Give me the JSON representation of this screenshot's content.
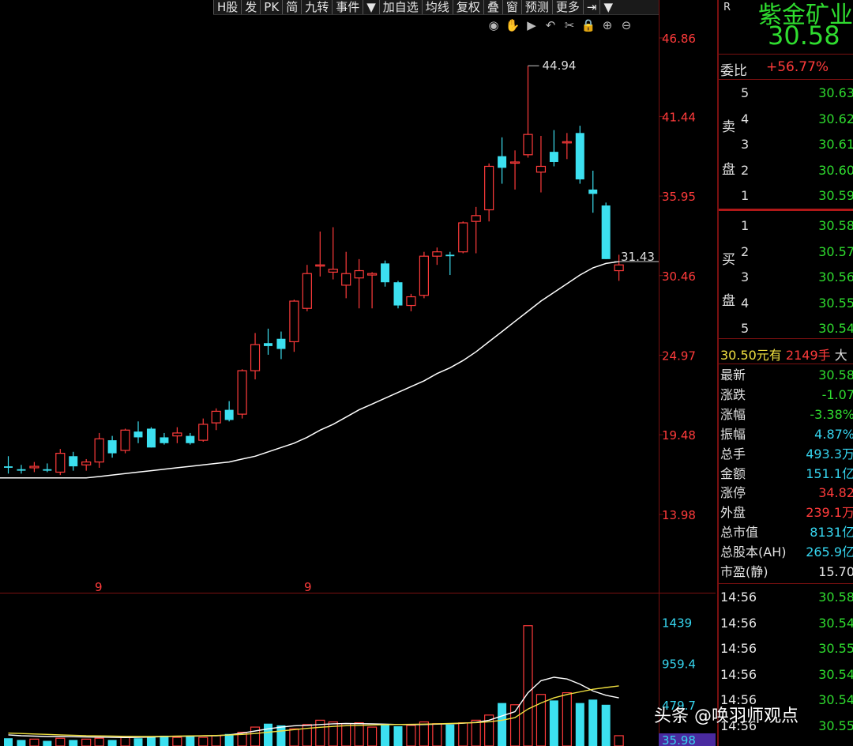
{
  "toolbar": {
    "items": [
      "H股",
      "发",
      "PK",
      "简",
      "九转",
      "事件",
      "▼",
      "加自选",
      "均线",
      "复权",
      "叠",
      "窗",
      "预测",
      "更多",
      "⇥",
      "▼"
    ]
  },
  "chart_tools": {
    "icons": [
      "eye-icon",
      "hand-icon",
      "play-icon",
      "undo-icon",
      "scissors-icon",
      "lock-icon",
      "zoom-in-icon",
      "zoom-out-icon"
    ]
  },
  "price_axis": {
    "ticks": [
      "46.86",
      "41.44",
      "35.95",
      "30.46",
      "24.97",
      "19.48",
      "13.98"
    ]
  },
  "volume_axis": {
    "ticks": [
      "1439",
      "959.4",
      "479.7",
      "35.98"
    ]
  },
  "annotations": {
    "high": "44.94",
    "ma_value": "31.43",
    "month_marks": [
      "9",
      "9"
    ]
  },
  "colors": {
    "up": "#ff3b3b",
    "down": "#3ce0f0",
    "ma": "#ffffff",
    "vol_ma1": "#ffffff",
    "vol_ma2": "#f0e040",
    "grid": "#7a1010"
  },
  "chart_data": {
    "type": "candlestick",
    "ylim": [
      13.98,
      46.86
    ],
    "candles": [
      {
        "o": 17.3,
        "h": 18.0,
        "l": 16.8,
        "c": 17.2
      },
      {
        "o": 17.1,
        "h": 17.4,
        "l": 16.8,
        "c": 17.0
      },
      {
        "o": 17.2,
        "h": 17.6,
        "l": 16.9,
        "c": 17.3
      },
      {
        "o": 17.1,
        "h": 17.5,
        "l": 16.9,
        "c": 17.0
      },
      {
        "o": 16.9,
        "h": 18.5,
        "l": 16.7,
        "c": 18.2
      },
      {
        "o": 18.0,
        "h": 18.3,
        "l": 17.0,
        "c": 17.3
      },
      {
        "o": 17.4,
        "h": 17.8,
        "l": 17.0,
        "c": 17.6
      },
      {
        "o": 17.6,
        "h": 19.6,
        "l": 17.2,
        "c": 19.2
      },
      {
        "o": 19.1,
        "h": 19.4,
        "l": 17.9,
        "c": 18.2
      },
      {
        "o": 18.4,
        "h": 19.9,
        "l": 18.2,
        "c": 19.8
      },
      {
        "o": 19.7,
        "h": 20.4,
        "l": 18.9,
        "c": 19.3
      },
      {
        "o": 19.9,
        "h": 20.0,
        "l": 18.6,
        "c": 18.6
      },
      {
        "o": 19.3,
        "h": 19.6,
        "l": 18.8,
        "c": 18.9
      },
      {
        "o": 19.4,
        "h": 20.0,
        "l": 18.9,
        "c": 19.6
      },
      {
        "o": 19.4,
        "h": 19.6,
        "l": 18.8,
        "c": 18.9
      },
      {
        "o": 19.1,
        "h": 20.6,
        "l": 19.0,
        "c": 20.2
      },
      {
        "o": 20.3,
        "h": 21.3,
        "l": 19.8,
        "c": 21.1
      },
      {
        "o": 21.2,
        "h": 21.8,
        "l": 20.4,
        "c": 20.5
      },
      {
        "o": 20.9,
        "h": 24.0,
        "l": 20.6,
        "c": 23.9
      },
      {
        "o": 23.9,
        "h": 26.5,
        "l": 23.3,
        "c": 25.7
      },
      {
        "o": 25.8,
        "h": 26.8,
        "l": 25.0,
        "c": 25.6
      },
      {
        "o": 26.1,
        "h": 26.6,
        "l": 24.7,
        "c": 25.4
      },
      {
        "o": 25.9,
        "h": 28.8,
        "l": 25.2,
        "c": 28.7
      },
      {
        "o": 28.2,
        "h": 31.2,
        "l": 28.0,
        "c": 30.6
      },
      {
        "o": 31.2,
        "h": 33.5,
        "l": 30.4,
        "c": 31.2
      },
      {
        "o": 30.7,
        "h": 33.8,
        "l": 30.2,
        "c": 30.9
      },
      {
        "o": 29.8,
        "h": 32.1,
        "l": 28.9,
        "c": 30.6
      },
      {
        "o": 30.3,
        "h": 31.6,
        "l": 28.2,
        "c": 30.8
      },
      {
        "o": 30.5,
        "h": 30.7,
        "l": 28.2,
        "c": 30.6
      },
      {
        "o": 31.3,
        "h": 31.5,
        "l": 29.7,
        "c": 30.0
      },
      {
        "o": 30.0,
        "h": 30.1,
        "l": 28.2,
        "c": 28.4
      },
      {
        "o": 28.4,
        "h": 29.2,
        "l": 28.0,
        "c": 29.0
      },
      {
        "o": 29.1,
        "h": 32.1,
        "l": 28.9,
        "c": 31.8
      },
      {
        "o": 31.8,
        "h": 32.4,
        "l": 31.2,
        "c": 32.1
      },
      {
        "o": 31.9,
        "h": 32.1,
        "l": 30.5,
        "c": 31.8
      },
      {
        "o": 32.1,
        "h": 34.2,
        "l": 32.0,
        "c": 34.1
      },
      {
        "o": 34.2,
        "h": 35.2,
        "l": 32.0,
        "c": 34.6
      },
      {
        "o": 35.0,
        "h": 38.2,
        "l": 34.2,
        "c": 38.0
      },
      {
        "o": 38.7,
        "h": 40.0,
        "l": 36.8,
        "c": 37.9
      },
      {
        "o": 38.3,
        "h": 39.1,
        "l": 36.4,
        "c": 38.3
      },
      {
        "o": 38.8,
        "h": 44.94,
        "l": 38.6,
        "c": 40.2
      },
      {
        "o": 37.6,
        "h": 40.1,
        "l": 36.2,
        "c": 38.0
      },
      {
        "o": 39.0,
        "h": 40.5,
        "l": 38.0,
        "c": 38.3
      },
      {
        "o": 39.7,
        "h": 40.3,
        "l": 38.5,
        "c": 39.7
      },
      {
        "o": 40.3,
        "h": 40.8,
        "l": 36.8,
        "c": 37.1
      },
      {
        "o": 36.4,
        "h": 37.7,
        "l": 34.8,
        "c": 36.1
      },
      {
        "o": 35.3,
        "h": 35.5,
        "l": 31.6,
        "c": 31.6
      },
      {
        "o": 30.8,
        "h": 31.9,
        "l": 30.1,
        "c": 31.2
      }
    ],
    "ma": [
      16.5,
      16.5,
      16.5,
      16.5,
      16.5,
      16.5,
      16.5,
      16.6,
      16.7,
      16.8,
      16.9,
      17.0,
      17.1,
      17.2,
      17.3,
      17.4,
      17.5,
      17.6,
      17.8,
      18.0,
      18.3,
      18.6,
      18.9,
      19.3,
      19.8,
      20.2,
      20.7,
      21.2,
      21.6,
      22.0,
      22.4,
      22.8,
      23.2,
      23.7,
      24.1,
      24.6,
      25.2,
      25.9,
      26.6,
      27.3,
      28.0,
      28.7,
      29.3,
      29.9,
      30.5,
      31.0,
      31.3,
      31.43
    ],
    "volume": {
      "ylim": [
        0,
        1600
      ],
      "bars": [
        90,
        70,
        80,
        60,
        90,
        70,
        80,
        90,
        70,
        100,
        90,
        110,
        120,
        100,
        110,
        100,
        120,
        140,
        160,
        220,
        260,
        240,
        200,
        250,
        300,
        280,
        260,
        270,
        220,
        250,
        230,
        240,
        280,
        260,
        250,
        270,
        300,
        360,
        500,
        480,
        1400,
        600,
        530,
        620,
        500,
        540,
        480,
        120
      ],
      "ma5": [
        130,
        120,
        115,
        110,
        110,
        108,
        105,
        103,
        100,
        98,
        100,
        104,
        110,
        112,
        115,
        118,
        120,
        130,
        150,
        175,
        200,
        220,
        235,
        240,
        250,
        258,
        262,
        260,
        258,
        255,
        250,
        248,
        250,
        255,
        258,
        265,
        275,
        300,
        350,
        400,
        620,
        760,
        800,
        780,
        720,
        640,
        590,
        560
      ],
      "ma10": [
        150,
        145,
        140,
        135,
        130,
        125,
        120,
        118,
        115,
        112,
        110,
        110,
        112,
        115,
        118,
        120,
        122,
        128,
        135,
        145,
        160,
        175,
        190,
        205,
        218,
        228,
        236,
        240,
        245,
        248,
        250,
        252,
        255,
        258,
        262,
        268,
        272,
        282,
        300,
        330,
        430,
        500,
        560,
        600,
        630,
        660,
        680,
        700
      ]
    }
  },
  "side": {
    "stock_name": "紫金矿业",
    "market_tag": "R",
    "price": "30.58",
    "weibi_label": "委比",
    "weibi_value": "+56.77%",
    "sell_label_1": "卖",
    "sell_label_2": "盘",
    "buy_label_1": "买",
    "buy_label_2": "盘",
    "sell_levels": [
      {
        "n": "5",
        "p": "30.63"
      },
      {
        "n": "4",
        "p": "30.62"
      },
      {
        "n": "3",
        "p": "30.61"
      },
      {
        "n": "2",
        "p": "30.60"
      },
      {
        "n": "1",
        "p": "30.59"
      }
    ],
    "buy_levels": [
      {
        "n": "1",
        "p": "30.58"
      },
      {
        "n": "2",
        "p": "30.57"
      },
      {
        "n": "3",
        "p": "30.56"
      },
      {
        "n": "4",
        "p": "30.55"
      },
      {
        "n": "5",
        "p": "30.54"
      }
    ],
    "order_note_price": "30.50元有",
    "order_note_qty": "2149手",
    "order_note_tail": "大",
    "stats": [
      {
        "label": "最新",
        "value": "30.58",
        "color": "green"
      },
      {
        "label": "涨跌",
        "value": "-1.07",
        "color": "green"
      },
      {
        "label": "涨幅",
        "value": "-3.38%",
        "color": "green"
      },
      {
        "label": "振幅",
        "value": "4.87%",
        "color": "cyan"
      },
      {
        "label": "总手",
        "value": "493.3万",
        "color": "cyan"
      },
      {
        "label": "金额",
        "value": "151.1亿",
        "color": "cyan"
      },
      {
        "label": "涨停",
        "value": "34.82",
        "color": "red"
      },
      {
        "label": "外盘",
        "value": "239.1万",
        "color": "red"
      },
      {
        "label": "总市值",
        "value": "8131亿",
        "color": "cyan"
      },
      {
        "label": "总股本(AH)",
        "value": "265.9亿",
        "color": "cyan"
      },
      {
        "label": "市盈(静)",
        "value": "15.70",
        "color": "white"
      }
    ],
    "ticks": [
      {
        "time": "14:56",
        "price": "30.58"
      },
      {
        "time": "14:56",
        "price": "30.54"
      },
      {
        "time": "14:56",
        "price": "30.55"
      },
      {
        "time": "14:56",
        "price": "30.54"
      },
      {
        "time": "14:56",
        "price": "30.54"
      },
      {
        "time": "14:56",
        "price": "30.55"
      }
    ]
  },
  "watermark": "头条 @唤羽师观点"
}
